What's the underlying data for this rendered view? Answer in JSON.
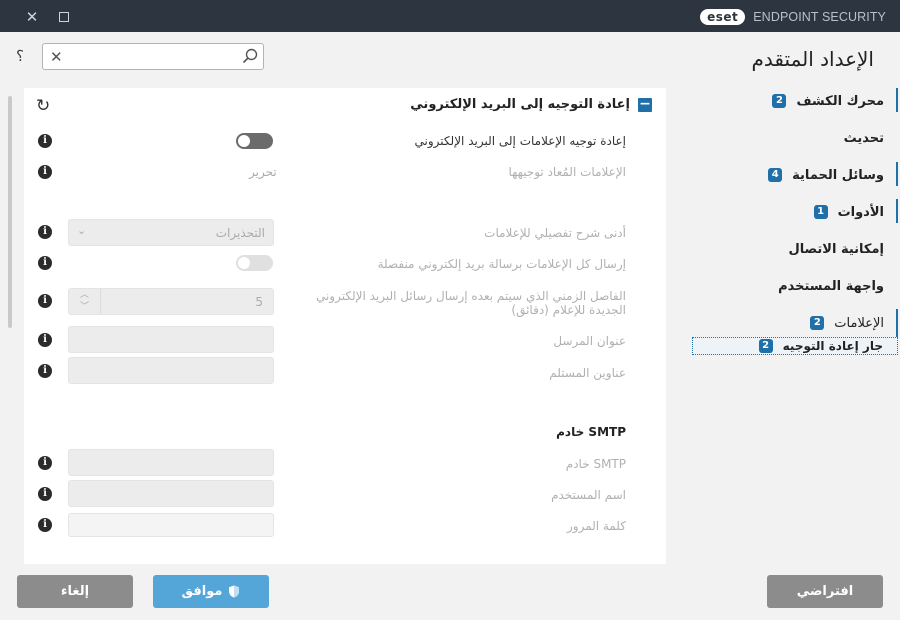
{
  "titlebar": {
    "logo": "eset",
    "product": "ENDPOINT SECURITY",
    "close_icon": "✕",
    "maximize_icon": "□"
  },
  "help": "؟",
  "search": {
    "value": "",
    "placeholder": ""
  },
  "page_title": "الإعداد المتقدم",
  "sidebar": {
    "items": [
      {
        "label": "محرك الكشف",
        "badge": "2"
      },
      {
        "label": "تحديث",
        "badge": ""
      },
      {
        "label": "وسائل الحماية",
        "badge": "4"
      },
      {
        "label": "الأدوات",
        "badge": "1"
      },
      {
        "label": "إمكانية الاتصال",
        "badge": ""
      },
      {
        "label": "واجهة المستخدم",
        "badge": ""
      },
      {
        "label": "الإعلامات",
        "badge": "2"
      }
    ],
    "sub_item": {
      "label": "جار إعادة التوجيه",
      "badge": "2"
    }
  },
  "main": {
    "section_title": "إعادة التوجيه إلى البريد الإلكتروني",
    "collapse_symbol": "−",
    "revert_symbol": "↻",
    "rows": {
      "forward_toggle": "إعادة توجيه الإعلامات إلى البريد الإلكتروني",
      "forwarded": "الإعلامات المُعاد توجيهها",
      "edit": "تحرير",
      "min_verbosity": "أدنى شرح تفصيلي للإعلامات",
      "min_verbosity_value": "التحذيرات",
      "separate_emails": "إرسال كل الإعلامات برسالة بريد إلكتروني منفصلة",
      "interval_line1": "الفاصل الزمني الذي سيتم بعده إرسال رسائل البريد الإلكتروني",
      "interval_line2": "الجديدة للإعلام (دقائق)",
      "interval_value": "5",
      "sender": "عنوان المرسل",
      "recipients": "عناوين المستلم",
      "smtp_section": "خادم SMTP",
      "smtp_server": "خادم SMTP",
      "username": "اسم المستخدم",
      "password": "كلمة المرور"
    },
    "forward_enabled": false,
    "separate_enabled": false
  },
  "buttons": {
    "cancel": "إلغاء",
    "ok": "موافق",
    "default": "افتراضي"
  },
  "colors": {
    "accent": "#1f6fa8",
    "ok_button": "#54a6d8",
    "titlebar": "#2d3640"
  }
}
